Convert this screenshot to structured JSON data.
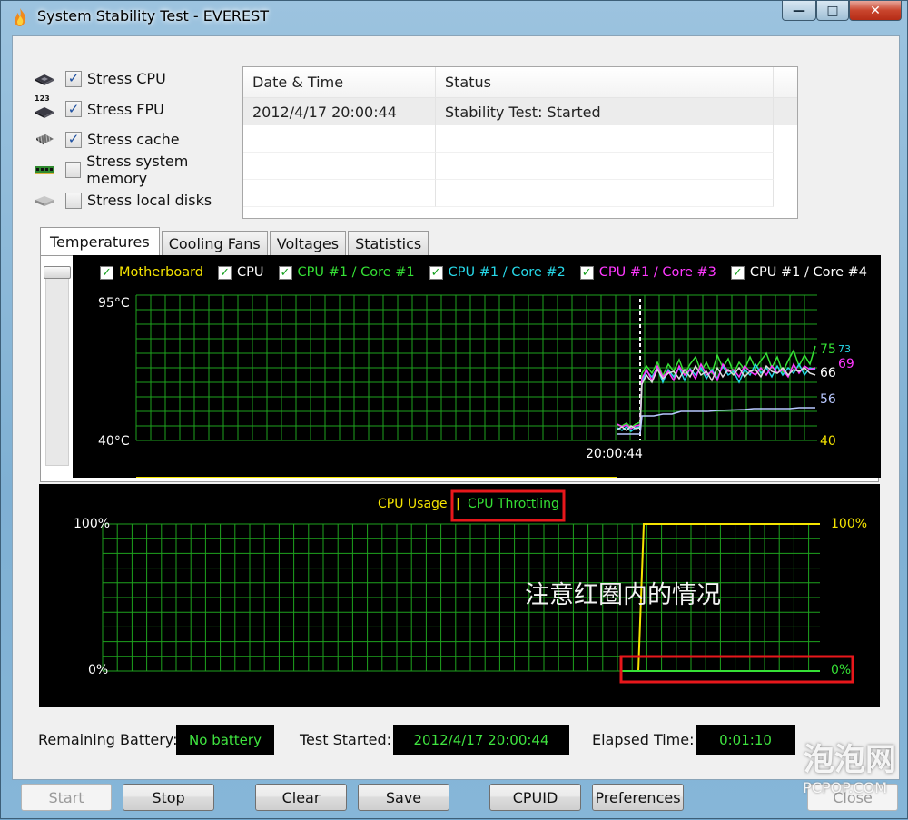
{
  "window": {
    "title": "System Stability Test - EVEREST"
  },
  "stress": [
    {
      "label": "Stress CPU",
      "checked": true,
      "icon": "cpu-chip-icon"
    },
    {
      "label": "Stress FPU",
      "checked": true,
      "icon": "fpu-chip-icon"
    },
    {
      "label": "Stress cache",
      "checked": true,
      "icon": "cache-chip-icon"
    },
    {
      "label": "Stress system memory",
      "checked": false,
      "icon": "memory-module-icon"
    },
    {
      "label": "Stress local disks",
      "checked": false,
      "icon": "disk-drive-icon"
    }
  ],
  "fpu_icon_text": "123",
  "log": {
    "headers": [
      "Date & Time",
      "Status"
    ],
    "rows": [
      [
        "2012/4/17 20:00:44",
        "Stability Test: Started"
      ]
    ]
  },
  "tabs": [
    "Temperatures",
    "Cooling Fans",
    "Voltages",
    "Statistics"
  ],
  "temp_graph": {
    "legend": [
      {
        "label": "Motherboard",
        "color": "#f5e400"
      },
      {
        "label": "CPU",
        "color": "#ffffff"
      },
      {
        "label": "CPU #1 / Core #1",
        "color": "#35e035"
      },
      {
        "label": "CPU #1 / Core #2",
        "color": "#27d8e8"
      },
      {
        "label": "CPU #1 / Core #3",
        "color": "#ff38ff"
      },
      {
        "label": "CPU #1 / Core #4",
        "color": "#ffffff"
      }
    ],
    "y_top": "95°C",
    "y_bottom": "40°C",
    "marker_time": "20:00:44",
    "right_labels": [
      {
        "text": "75",
        "color": "#35e035"
      },
      {
        "text": "73",
        "color": "#27d8e8"
      },
      {
        "text": "69",
        "color": "#ff38ff"
      },
      {
        "text": "66",
        "color": "#ffffff"
      },
      {
        "text": "56",
        "color": "#b8c8ff"
      },
      {
        "text": "40",
        "color": "#f5e400"
      }
    ]
  },
  "cpu_graph": {
    "title_usage": "CPU Usage",
    "separator": "|",
    "title_throttle": "CPU Throttling",
    "y_top": "100%",
    "y_bottom": "0%",
    "right_top": "100%",
    "right_bottom": "0%",
    "annotation": "注意红圈内的情况",
    "colors": {
      "usage": "#f5e400",
      "throttle": "#35e035",
      "highlight": "#e8171b"
    }
  },
  "status": {
    "battery_label": "Remaining Battery:",
    "battery_value": "No battery",
    "started_label": "Test Started:",
    "started_value": "2012/4/17 20:00:44",
    "elapsed_label": "Elapsed Time:",
    "elapsed_value": "0:01:10"
  },
  "buttons": {
    "start": "Start",
    "stop": "Stop",
    "clear": "Clear",
    "save": "Save",
    "cpuid": "CPUID",
    "preferences": "Preferences",
    "close": "Close"
  },
  "watermark": {
    "brand": "泡泡网",
    "site": "PCPOP.COM"
  }
}
